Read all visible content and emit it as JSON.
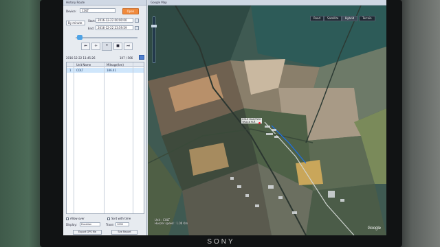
{
  "window": {
    "left_title": "History Route",
    "map_title": "Google Map"
  },
  "device": {
    "label": "Device:",
    "value": "COLT",
    "open_button": "Open"
  },
  "range": {
    "mode": "By minute",
    "start_label": "Start:",
    "start_value": "2016-12-22 00:00:00",
    "end_label": "End:",
    "end_value": "2016-12-22 23:59:59"
  },
  "playback": {
    "buttons": [
      "⏮",
      "✛",
      "⏸",
      "■",
      "⏭"
    ],
    "current_time": "2016-12-22 11:45:26",
    "position": "107 / 566"
  },
  "grid": {
    "headers": [
      "",
      "Unit Name",
      "Mileage(km)"
    ],
    "rows": [
      {
        "no": "1",
        "name": "COLT",
        "mileage": "186.41"
      }
    ]
  },
  "options": {
    "follow_label": "Allow over",
    "lbs_label": "Sort with time",
    "display_label": "Display:",
    "display_value": "Duration",
    "trace_label": "Trace:",
    "trace_value": "1000",
    "export_button": "Export GPS file",
    "report_button": "See Report"
  },
  "map": {
    "types": [
      "Road",
      "Satellite",
      "Hybrid",
      "Terrain"
    ],
    "active_type": "Hybrid",
    "marker_label": "COLE MAZ/PLR1\nTRUCK PLR",
    "overlay_line1": "Unit : COLT",
    "overlay_line2": "Huozer speed : 1.00 Km",
    "google": "Google"
  },
  "brand": "SONY"
}
